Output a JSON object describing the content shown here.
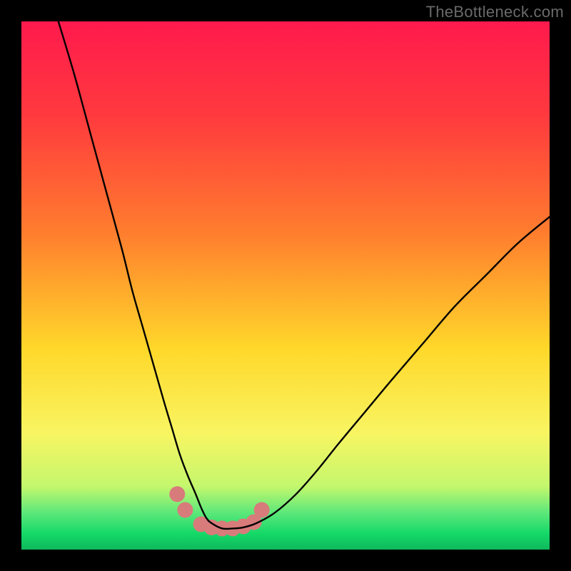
{
  "watermark": "TheBottleneck.com",
  "chart_data": {
    "type": "line",
    "title": "",
    "xlabel": "",
    "ylabel": "",
    "xlim": [
      0,
      100
    ],
    "ylim": [
      0,
      100
    ],
    "gradient_stops": [
      {
        "offset": 0,
        "color": "#ff1a4d"
      },
      {
        "offset": 0.18,
        "color": "#ff3a3e"
      },
      {
        "offset": 0.4,
        "color": "#ff7d2e"
      },
      {
        "offset": 0.62,
        "color": "#ffd82a"
      },
      {
        "offset": 0.78,
        "color": "#f8f562"
      },
      {
        "offset": 0.88,
        "color": "#c4f76d"
      },
      {
        "offset": 0.93,
        "color": "#5de87a"
      },
      {
        "offset": 0.97,
        "color": "#14d968"
      },
      {
        "offset": 1.0,
        "color": "#0fb85c"
      }
    ],
    "series": [
      {
        "name": "bottleneck-curve",
        "type": "line",
        "color": "#000000",
        "width": 2.4,
        "x": [
          7,
          10,
          13,
          16,
          19,
          21,
          23,
          25,
          27,
          28.5,
          30,
          31.5,
          33,
          34,
          35,
          36,
          38,
          40,
          42,
          44.5,
          48,
          52,
          56,
          60,
          65,
          70,
          76,
          82,
          88,
          94,
          100
        ],
        "y": [
          100,
          90,
          79,
          68,
          57,
          49,
          42,
          35,
          28,
          23,
          18,
          14,
          10.5,
          8,
          6,
          5,
          4,
          4,
          4.2,
          5,
          7,
          10.5,
          15,
          20,
          26,
          32,
          39,
          46,
          52,
          58,
          63
        ]
      },
      {
        "name": "bottom-markers",
        "type": "scatter",
        "color": "#d87b7b",
        "radius": 11,
        "x": [
          29.5,
          31,
          34,
          36,
          38,
          40,
          42,
          44,
          45.5
        ],
        "y": [
          10.5,
          7.5,
          4.8,
          4.2,
          4,
          4,
          4.4,
          5.2,
          7.5
        ]
      }
    ]
  }
}
